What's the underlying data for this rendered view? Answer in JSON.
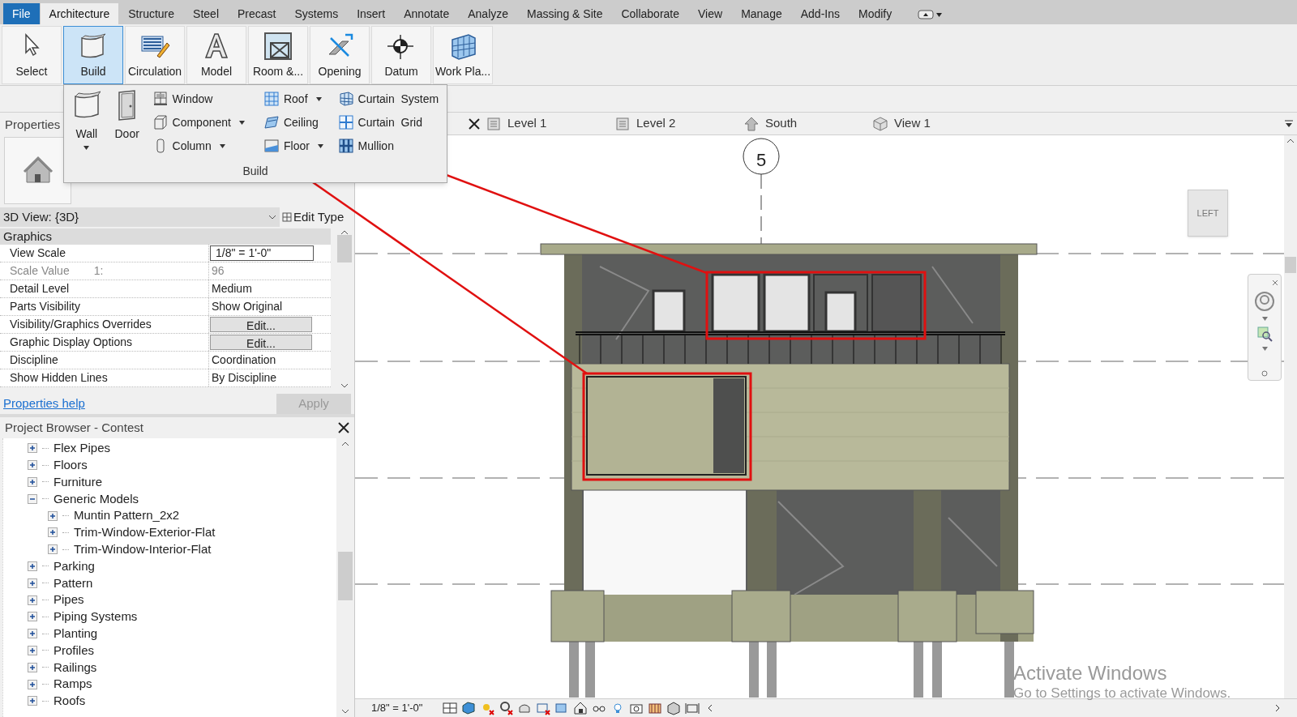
{
  "ribbon_tabs": [
    {
      "label": "File",
      "kind": "file",
      "selected": false
    },
    {
      "label": "Architecture",
      "kind": "tab",
      "selected": true
    },
    {
      "label": "Structure",
      "kind": "tab",
      "selected": false
    },
    {
      "label": "Steel",
      "kind": "tab",
      "selected": false
    },
    {
      "label": "Precast",
      "kind": "tab",
      "selected": false
    },
    {
      "label": "Systems",
      "kind": "tab",
      "selected": false
    },
    {
      "label": "Insert",
      "kind": "tab",
      "selected": false
    },
    {
      "label": "Annotate",
      "kind": "tab",
      "selected": false
    },
    {
      "label": "Analyze",
      "kind": "tab",
      "selected": false
    },
    {
      "label": "Massing & Site",
      "kind": "tab",
      "selected": false
    },
    {
      "label": "Collaborate",
      "kind": "tab",
      "selected": false
    },
    {
      "label": "View",
      "kind": "tab",
      "selected": false
    },
    {
      "label": "Manage",
      "kind": "tab",
      "selected": false
    },
    {
      "label": "Add-Ins",
      "kind": "tab",
      "selected": false
    },
    {
      "label": "Modify",
      "kind": "tab",
      "selected": false
    }
  ],
  "ribbon_buttons": [
    {
      "label": "Select",
      "kind": "select",
      "selected": false
    },
    {
      "label": "Build",
      "kind": "build",
      "selected": true
    },
    {
      "label": "Circulation",
      "kind": "circulation",
      "selected": false
    },
    {
      "label": "Model",
      "kind": "model",
      "selected": false
    },
    {
      "label": "Room &...",
      "kind": "room",
      "selected": false
    },
    {
      "label": "Opening",
      "kind": "opening",
      "selected": false
    },
    {
      "label": "Datum",
      "kind": "datum",
      "selected": false
    },
    {
      "label": "Work Pla...",
      "kind": "workplane",
      "selected": false
    }
  ],
  "build_panel": {
    "title": "Build",
    "large_tools": [
      {
        "label": "Wall",
        "kind": "wall",
        "dropdown": true
      },
      {
        "label": "Door",
        "kind": "door",
        "dropdown": false
      }
    ],
    "tools": [
      {
        "label": "Window",
        "kind": "window",
        "dropdown": false
      },
      {
        "label": "Component",
        "kind": "component",
        "dropdown": true
      },
      {
        "label": "Column",
        "kind": "column",
        "dropdown": true
      },
      {
        "label": "Roof",
        "kind": "roof",
        "dropdown": true
      },
      {
        "label": "Ceiling",
        "kind": "ceiling",
        "dropdown": false
      },
      {
        "label": "Floor",
        "kind": "floor",
        "dropdown": true
      },
      {
        "label": "Curtain  System",
        "kind": "curtain-system",
        "dropdown": false
      },
      {
        "label": "Curtain  Grid",
        "kind": "curtain-grid",
        "dropdown": false
      },
      {
        "label": "Mullion",
        "kind": "mullion",
        "dropdown": false
      }
    ]
  },
  "properties": {
    "title": "Properties",
    "type_selector": "3D View: {3D}",
    "edit_type": "Edit Type",
    "group": "Graphics",
    "rows": [
      {
        "name": "View Scale",
        "value": "1/8\" = 1'-0\"",
        "kind": "field"
      },
      {
        "name": "Scale Value",
        "prefix": "1:",
        "value": "96",
        "kind": "readonly"
      },
      {
        "name": "Detail Level",
        "value": "Medium",
        "kind": "text"
      },
      {
        "name": "Parts Visibility",
        "value": "Show Original",
        "kind": "text"
      },
      {
        "name": "Visibility/Graphics Overrides",
        "value": "Edit...",
        "kind": "button"
      },
      {
        "name": "Graphic Display Options",
        "value": "Edit...",
        "kind": "button"
      },
      {
        "name": "Discipline",
        "value": "Coordination",
        "kind": "text"
      },
      {
        "name": "Show Hidden Lines",
        "value": "By Discipline",
        "kind": "text"
      }
    ],
    "help_link": "Properties help",
    "apply_button": {
      "label": "Apply",
      "disabled": true
    }
  },
  "project_browser": {
    "title": "Project Browser - Contest",
    "items": [
      {
        "label": "Flex Pipes",
        "expanded": false
      },
      {
        "label": "Floors",
        "expanded": false
      },
      {
        "label": "Furniture",
        "expanded": false
      },
      {
        "label": "Generic Models",
        "expanded": true,
        "children": [
          {
            "label": "Muntin Pattern_2x2",
            "expanded": false
          },
          {
            "label": "Trim-Window-Exterior-Flat",
            "expanded": false
          },
          {
            "label": "Trim-Window-Interior-Flat",
            "expanded": false
          }
        ]
      },
      {
        "label": "Parking",
        "expanded": false
      },
      {
        "label": "Pattern",
        "expanded": false
      },
      {
        "label": "Pipes",
        "expanded": false
      },
      {
        "label": "Piping Systems",
        "expanded": false
      },
      {
        "label": "Planting",
        "expanded": false
      },
      {
        "label": "Profiles",
        "expanded": false
      },
      {
        "label": "Railings",
        "expanded": false
      },
      {
        "label": "Ramps",
        "expanded": false
      },
      {
        "label": "Roofs",
        "expanded": false
      }
    ]
  },
  "view_tabs": [
    {
      "label": "Level 1",
      "kind": "plan"
    },
    {
      "label": "Level 2",
      "kind": "plan"
    },
    {
      "label": "South",
      "kind": "elevation"
    },
    {
      "label": "View 1",
      "kind": "cube"
    }
  ],
  "view": {
    "grid_label": "5",
    "view_cube": "LEFT"
  },
  "status_bar": {
    "scale": "1/8\" = 1'-0\""
  },
  "system_notice": {
    "title": "Activate Windows",
    "subtitle": "Go to Settings to activate Windows."
  }
}
